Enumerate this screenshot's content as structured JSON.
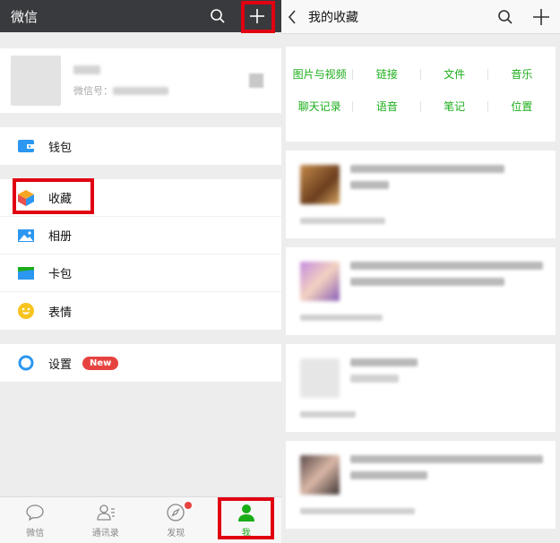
{
  "left": {
    "title": "微信",
    "profile": {
      "name": "",
      "wechat_id_label": "微信号：",
      "wechat_id_value": ""
    },
    "menu_groups": [
      [
        {
          "key": "wallet",
          "label": "钱包"
        }
      ],
      [
        {
          "key": "favorites",
          "label": "收藏"
        },
        {
          "key": "album",
          "label": "相册"
        },
        {
          "key": "cards",
          "label": "卡包"
        },
        {
          "key": "stickers",
          "label": "表情"
        }
      ],
      [
        {
          "key": "settings",
          "label": "设置",
          "badge": "New"
        }
      ]
    ],
    "tabs": [
      {
        "label": "微信",
        "icon": "chat-bubble-icon",
        "active": false
      },
      {
        "label": "通讯录",
        "icon": "contacts-icon",
        "active": false
      },
      {
        "label": "发现",
        "icon": "compass-icon",
        "active": false,
        "dot": true
      },
      {
        "label": "我",
        "icon": "person-icon",
        "active": true
      }
    ]
  },
  "right": {
    "title": "我的收藏",
    "categories_row1": [
      "图片与视频",
      "链接",
      "文件",
      "音乐"
    ],
    "categories_row2": [
      "聊天记录",
      "语音",
      "笔记",
      "位置"
    ],
    "items": [
      {
        "type": "image"
      },
      {
        "type": "image"
      },
      {
        "type": "file"
      },
      {
        "type": "image"
      }
    ]
  },
  "colors": {
    "accent_green": "#1aad19",
    "highlight_red": "#e00012",
    "badge_red": "#e64340",
    "topbar_dark": "#393a3e"
  }
}
